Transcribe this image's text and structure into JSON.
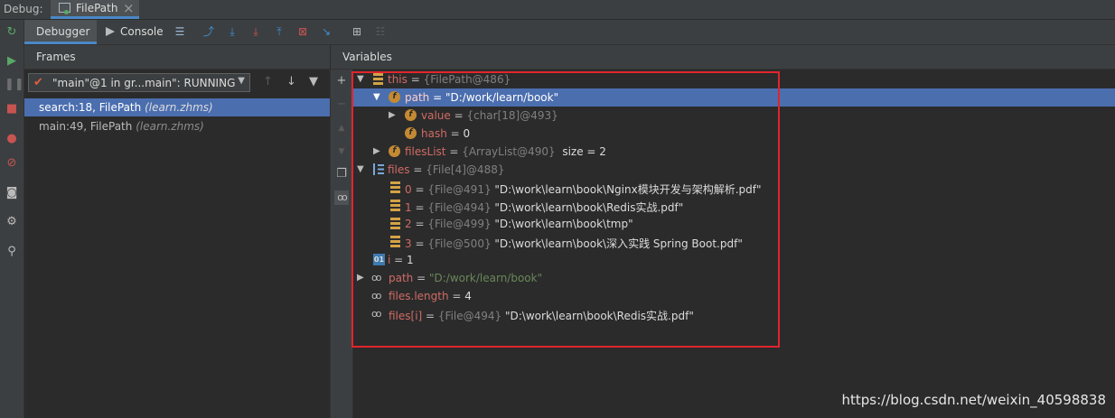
{
  "topbar": {
    "debug_label": "Debug:",
    "tab_title": "FilePath"
  },
  "toolbar": {
    "debugger_tab": "Debugger",
    "console_tab": "Console"
  },
  "frames": {
    "header": "Frames",
    "thread_selected": "\"main\"@1 in gr...main\": RUNNING",
    "items": [
      {
        "method": "search:18, FilePath ",
        "package": "(learn.zhms)",
        "selected": true
      },
      {
        "method": "main:49, FilePath ",
        "package": "(learn.zhms)",
        "selected": false
      }
    ]
  },
  "variables": {
    "header": "Variables",
    "this": {
      "name": "this",
      "eq": " = ",
      "type": "{FilePath@486}"
    },
    "path": {
      "name": "path",
      "eq": " = ",
      "value": "\"D:/work/learn/book\""
    },
    "value": {
      "name": "value",
      "eq": " = ",
      "type": "{char[18]@493}"
    },
    "hash": {
      "name": "hash",
      "eq": " = ",
      "value": "0"
    },
    "filesList": {
      "name": "filesList",
      "eq": " = ",
      "type": "{ArrayList@490}",
      "extra": "  size = 2"
    },
    "files": {
      "name": "files",
      "eq": " = ",
      "type": "{File[4]@488}"
    },
    "file_items": [
      {
        "index": "0",
        "eq": " = ",
        "type": "{File@491}",
        "value": " \"D:\\work\\learn\\book\\Nginx模块开发与架构解析.pdf\""
      },
      {
        "index": "1",
        "eq": " = ",
        "type": "{File@494}",
        "value": " \"D:\\work\\learn\\book\\Redis实战.pdf\""
      },
      {
        "index": "2",
        "eq": " = ",
        "type": "{File@499}",
        "value": " \"D:\\work\\learn\\book\\tmp\""
      },
      {
        "index": "3",
        "eq": " = ",
        "type": "{File@500}",
        "value": " \"D:\\work\\learn\\book\\深入实践 Spring Boot.pdf\""
      }
    ],
    "i": {
      "name": "i",
      "eq": " = ",
      "value": "1",
      "icon_text": "01"
    },
    "watch_path": {
      "name": "path",
      "eq": " = ",
      "value": "\"D:/work/learn/book\""
    },
    "watch_len": {
      "name": "files.length",
      "eq": " = ",
      "value": "4"
    },
    "watch_fi": {
      "name": "files[i]",
      "eq": " = ",
      "type": "{File@494}",
      "value": " \"D:\\work\\learn\\book\\Redis实战.pdf\""
    }
  },
  "watermark": "https://blog.csdn.net/weixin_40598838",
  "colors": {
    "accent": "#4b6eaf",
    "highlight_box": "#e0252d",
    "background": "#2b2b2b"
  }
}
